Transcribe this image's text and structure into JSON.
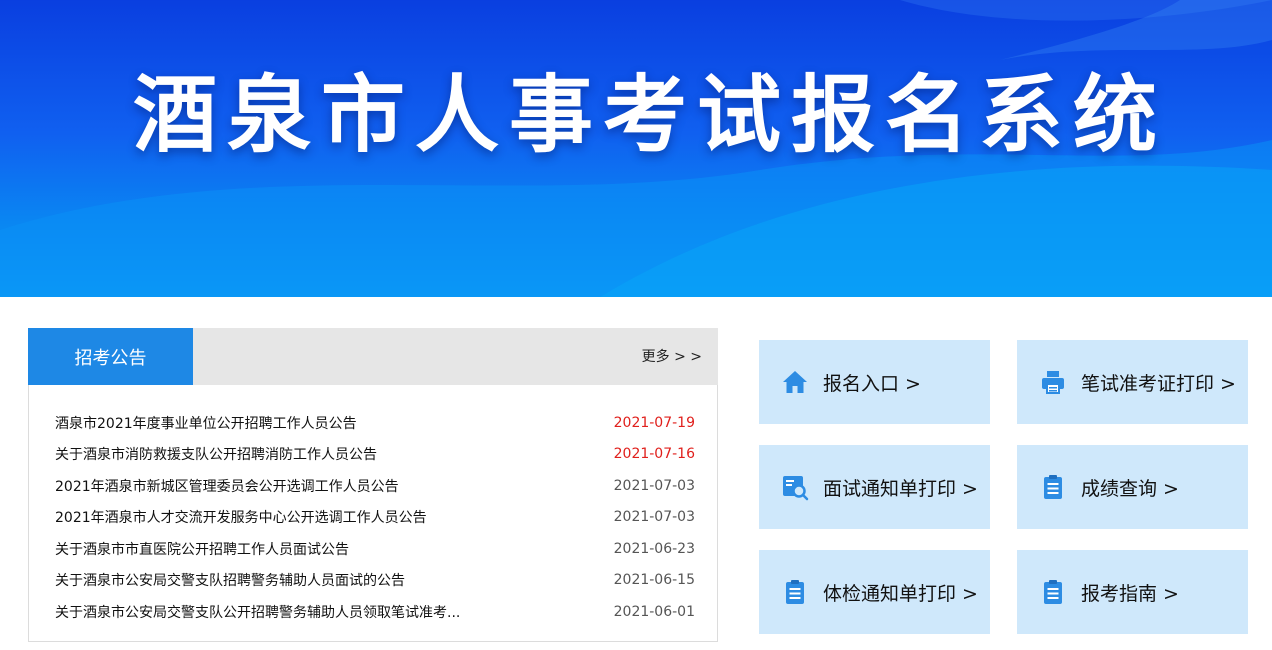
{
  "banner": {
    "title": "酒泉市人事考试报名系统"
  },
  "notices": {
    "tab_label": "招考公告",
    "more_label": "更多 > >",
    "items": [
      {
        "title": "酒泉市2021年度事业单位公开招聘工作人员公告",
        "date": "2021-07-19",
        "recent": true
      },
      {
        "title": "关于酒泉市消防救援支队公开招聘消防工作人员公告",
        "date": "2021-07-16",
        "recent": true
      },
      {
        "title": "2021年酒泉市新城区管理委员会公开选调工作人员公告",
        "date": "2021-07-03",
        "recent": false
      },
      {
        "title": "2021年酒泉市人才交流开发服务中心公开选调工作人员公告",
        "date": "2021-07-03",
        "recent": false
      },
      {
        "title": "关于酒泉市市直医院公开招聘工作人员面试公告",
        "date": "2021-06-23",
        "recent": false
      },
      {
        "title": "关于酒泉市公安局交警支队招聘警务辅助人员面试的公告",
        "date": "2021-06-15",
        "recent": false
      },
      {
        "title": "关于酒泉市公安局交警支队公开招聘警务辅助人员领取笔试准考...",
        "date": "2021-06-01",
        "recent": false
      }
    ]
  },
  "quick_links": [
    {
      "label": "报名入口 >",
      "icon": "home-icon"
    },
    {
      "label": "笔试准考证打印 >",
      "icon": "printer-icon"
    },
    {
      "label": "面试通知单打印 >",
      "icon": "document-search-icon"
    },
    {
      "label": "成绩查询 >",
      "icon": "clipboard-icon"
    },
    {
      "label": "体检通知单打印 >",
      "icon": "clipboard-icon"
    },
    {
      "label": "报考指南 >",
      "icon": "clipboard-icon"
    }
  ],
  "colors": {
    "accent": "#1e88e5",
    "tile_bg": "#cfe8fb",
    "recent_date": "#e0201c"
  }
}
